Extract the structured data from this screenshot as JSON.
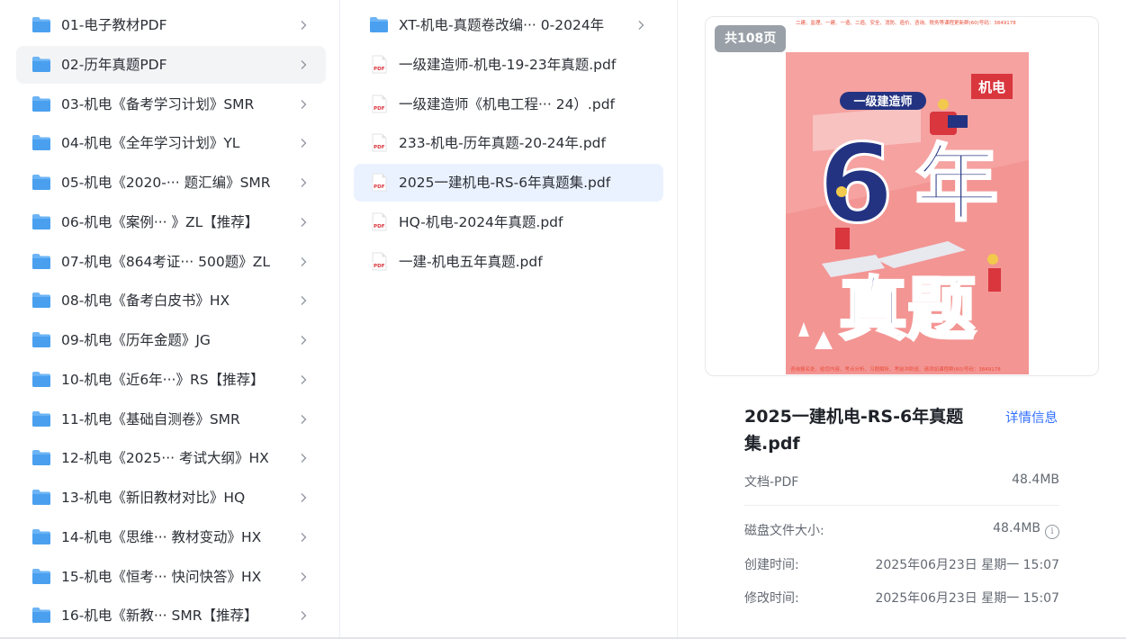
{
  "folders": [
    {
      "label": "01-电子教材PDF"
    },
    {
      "label": "02-历年真题PDF"
    },
    {
      "label": "03-机电《备考学习计划》SMR"
    },
    {
      "label": "04-机电《全年学习计划》YL"
    },
    {
      "label": "05-机电《2020-··· 题汇编》SMR"
    },
    {
      "label": "06-机电《案例···  》ZL【推荐】"
    },
    {
      "label": "07-机电《864考证··· 500题》ZL"
    },
    {
      "label": "08-机电《备考白皮书》HX"
    },
    {
      "label": "09-机电《历年金题》JG"
    },
    {
      "label": "10-机电《近6年···》RS【推荐】"
    },
    {
      "label": "11-机电《基础自测卷》SMR"
    },
    {
      "label": "12-机电《2025··· 考试大纲》HX"
    },
    {
      "label": "13-机电《新旧教材对比》HQ"
    },
    {
      "label": "14-机电《思维···  教材变动》HX"
    },
    {
      "label": "15-机电《恒考···  快问快答》HX"
    },
    {
      "label": "16-机电《新教···   SMR【推荐】"
    }
  ],
  "files": [
    {
      "label": "XT-机电-真题卷改编···  0-2024年",
      "type": "folder"
    },
    {
      "label": "一级建造师-机电-19-23年真题.pdf",
      "type": "pdf"
    },
    {
      "label": "一级建造师《机电工程···  24）.pdf",
      "type": "pdf"
    },
    {
      "label": "233-机电-历年真题-20-24年.pdf",
      "type": "pdf"
    },
    {
      "label": "2025一建机电-RS-6年真题集.pdf",
      "type": "pdf"
    },
    {
      "label": "HQ-机电-2024年真题.pdf",
      "type": "pdf"
    },
    {
      "label": "一建-机电五年真题.pdf",
      "type": "pdf"
    }
  ],
  "pdf_icon_text": "PDF",
  "preview": {
    "page_count": "共108页",
    "cover_title_top": "一级建造师",
    "cover_big_1": "6",
    "cover_big_2": "年",
    "cover_bottom": "真题",
    "cover_tag": "机电",
    "top_note": "二建、监理、一建、一造、二造、安全、消防、造价、咨询、税务等课程更新群(60)号码：3849178",
    "bottom_note": "咨询报名处、给您内容、考点分析、习题解析、考前冲刺班、请添加课程群(60)号码：3849178"
  },
  "details": {
    "file_name": "2025一建机电-RS-6年真题集.pdf",
    "detail_link": "详情信息",
    "type_label": "文档-PDF",
    "type_size": "48.4MB",
    "disk_label": "磁盘文件大小:",
    "disk_value": "48.4MB",
    "info_glyph": "i",
    "created_label": "创建时间:",
    "created_value": "2025年06月23日 星期一 15:07",
    "modified_label": "修改时间:",
    "modified_value": "2025年06月23日 星期一 15:07"
  },
  "colors": {
    "folder": "#5aa9f2",
    "pdf_red": "#d9363e",
    "selected_bg": "#ebf2ff",
    "link": "#3370ff",
    "cover_bg": "#f5a2a0",
    "cover_navy": "#233382"
  }
}
